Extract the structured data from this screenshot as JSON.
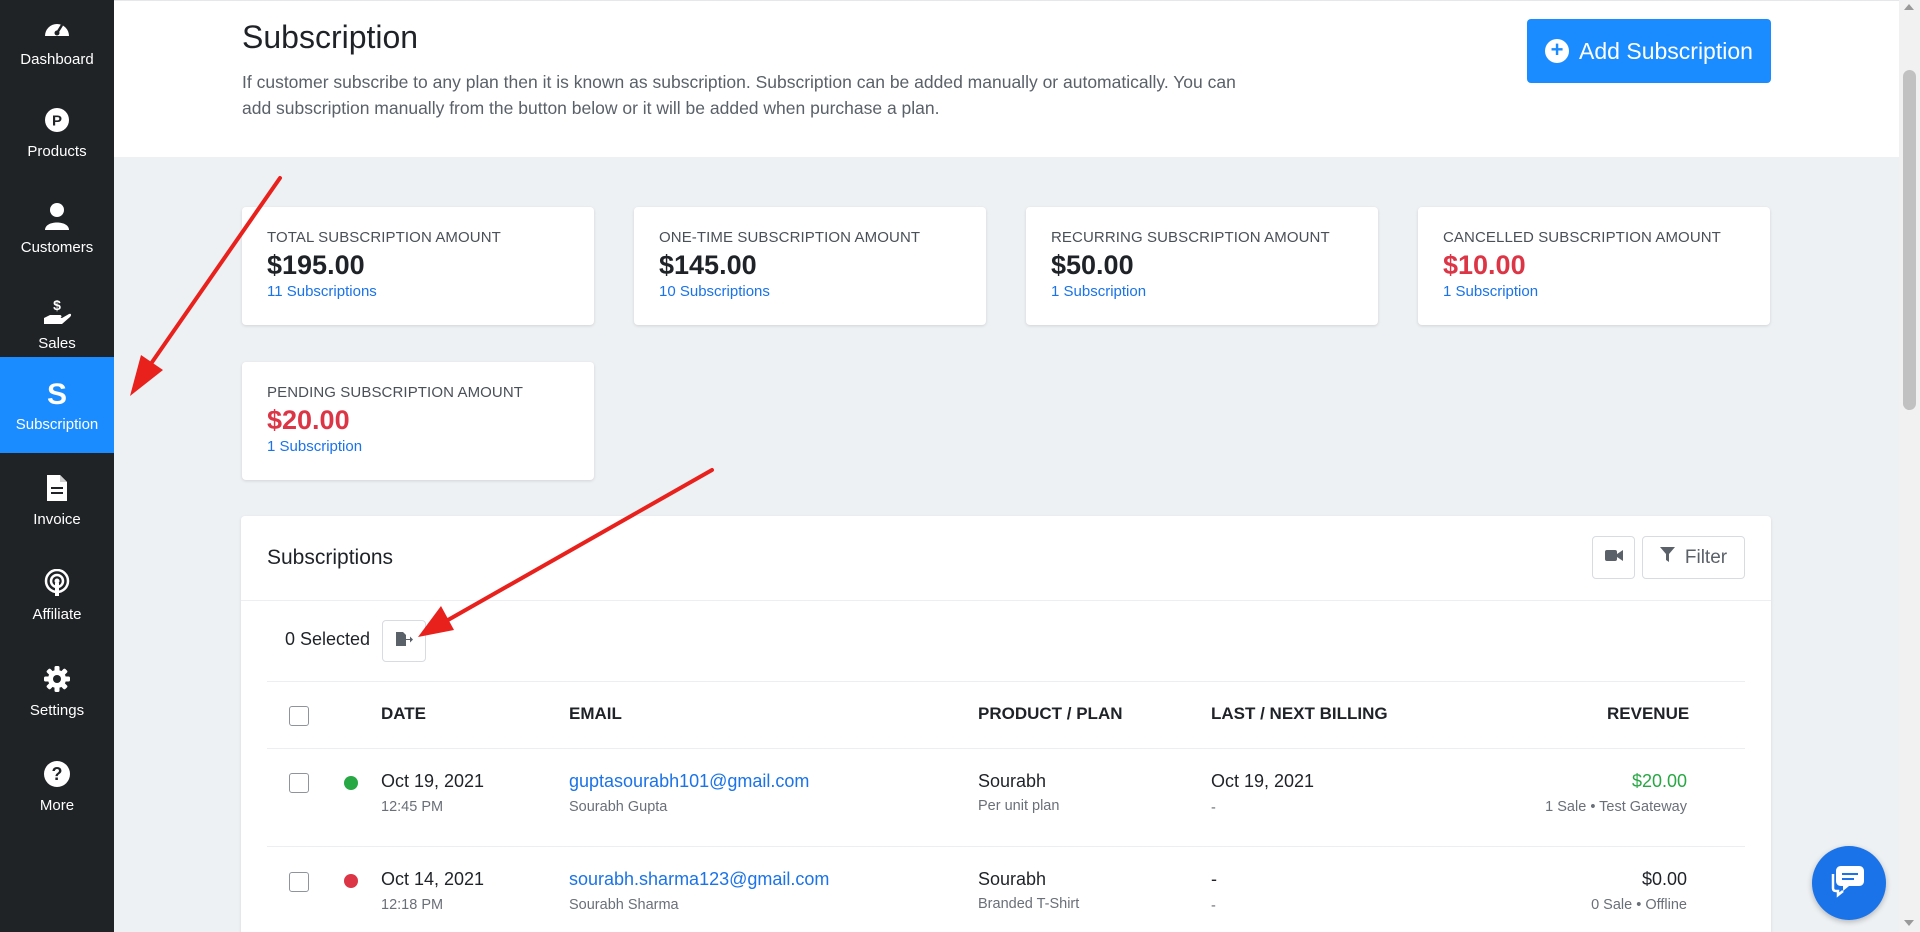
{
  "sidebar": {
    "items": [
      {
        "label": "Dashboard",
        "icon": "dashboard-icon"
      },
      {
        "label": "Products",
        "icon": "product-p-icon"
      },
      {
        "label": "Customers",
        "icon": "user-icon"
      },
      {
        "label": "Sales",
        "icon": "hand-dollar-icon"
      },
      {
        "label": "Subscription",
        "icon": "subscription-s-icon",
        "active": true
      },
      {
        "label": "Invoice",
        "icon": "document-icon"
      },
      {
        "label": "Affiliate",
        "icon": "broadcast-icon"
      },
      {
        "label": "Settings",
        "icon": "gear-icon"
      },
      {
        "label": "More",
        "icon": "question-icon"
      }
    ]
  },
  "header": {
    "title": "Subscription",
    "description": "If customer subscribe to any plan then it is known as subscription. Subscription can be added manually or automatically. You can add subscription manually from the button below or it will be added when purchase a plan.",
    "add_button_label": "Add Subscription"
  },
  "stats": [
    {
      "label": "TOTAL SUBSCRIPTION AMOUNT",
      "amount": "$195.00",
      "link": "11 Subscriptions",
      "color": "#1f2328"
    },
    {
      "label": "ONE-TIME SUBSCRIPTION AMOUNT",
      "amount": "$145.00",
      "link": "10 Subscriptions",
      "color": "#1f2328"
    },
    {
      "label": "RECURRING SUBSCRIPTION AMOUNT",
      "amount": "$50.00",
      "link": "1 Subscription",
      "color": "#1f2328"
    },
    {
      "label": "CANCELLED SUBSCRIPTION AMOUNT",
      "amount": "$10.00",
      "link": "1 Subscription",
      "color": "#dc3545"
    },
    {
      "label": "PENDING SUBSCRIPTION AMOUNT",
      "amount": "$20.00",
      "link": "1 Subscription",
      "color": "#dc3545"
    }
  ],
  "table": {
    "title": "Subscriptions",
    "filter_label": "Filter",
    "selected_text": "0 Selected",
    "columns": {
      "date": "DATE",
      "email": "EMAIL",
      "product": "PRODUCT / PLAN",
      "billing": "LAST / NEXT BILLING",
      "revenue": "REVENUE"
    },
    "rows": [
      {
        "status_color": "#28a745",
        "date": "Oct 19, 2021",
        "time": "12:45 PM",
        "email": "guptasourabh101@gmail.com",
        "name": "Sourabh Gupta",
        "product": "Sourabh",
        "plan": "Per unit plan",
        "billing": "Oct 19, 2021",
        "billing_sub": "-",
        "revenue": "$20.00",
        "revenue_sub": "1 Sale • Test Gateway"
      },
      {
        "status_color": "#dc3545",
        "date": "Oct 14, 2021",
        "time": "12:18 PM",
        "email": "sourabh.sharma123@gmail.com",
        "name": "Sourabh Sharma",
        "product": "Sourabh",
        "plan": "Branded T-Shirt",
        "billing": "-",
        "billing_sub": "-",
        "revenue": "$0.00",
        "revenue_sub": "0 Sale • Offline"
      }
    ]
  },
  "colors": {
    "sidebar_bg": "#1f2326",
    "accent": "#1a8cff",
    "danger": "#dc3545",
    "success": "#28a745",
    "annotation_arrow": "#e8211d"
  }
}
